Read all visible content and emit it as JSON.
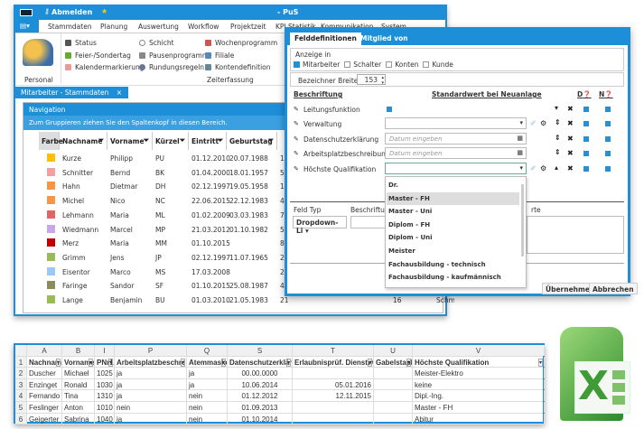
{
  "app": {
    "title": "- PuS",
    "logout": "Abmelden"
  },
  "ribbon": {
    "tabs": [
      "Stammdaten",
      "Planung",
      "Auswertung",
      "Workflow",
      "Projektzeit",
      "KPI Statistik",
      "Kommunikation",
      "System"
    ],
    "personal": "Personal",
    "group_label": "Zeiterfassung",
    "items": [
      "Status",
      "Feier-/Sondertag",
      "Kalendermarkierung",
      "Schicht",
      "Pausenprogramm",
      "Rundungsregeln",
      "Wochenprogramm",
      "Filiale",
      "Kontendefinition"
    ]
  },
  "doc_tab": {
    "label": "Mitarbeiter - Stammdaten",
    "close": "×"
  },
  "grid": {
    "nav": "Navigation",
    "group_hint": "Zum Gruppieren ziehen Sie den Spaltenkopf in diesen Bereich.",
    "columns": [
      "Farbe",
      "Nachname",
      "Vorname",
      "Kürzel",
      "Eintritt",
      "Geburtstag"
    ],
    "rows": [
      {
        "color": "#ffc000",
        "c": [
          "Kurze",
          "Philipp",
          "PU",
          "01.12.2010",
          "20.07.1988",
          "1"
        ]
      },
      {
        "color": "#f4a0a0",
        "c": [
          "Schnitter",
          "Bernd",
          "BK",
          "01.04.2000",
          "18.01.1957",
          "5"
        ]
      },
      {
        "color": "#f79646",
        "c": [
          "Hahn",
          "Dietmar",
          "DH",
          "02.12.1997",
          "19.05.1958",
          "1"
        ]
      },
      {
        "color": "#f79646",
        "c": [
          "Michel",
          "Nico",
          "NC",
          "22.06.2015",
          "22.12.1983",
          "4"
        ]
      },
      {
        "color": "#e06666",
        "c": [
          "Lehmann",
          "Maria",
          "ML",
          "01.02.2009",
          "03.03.1983",
          "7"
        ]
      },
      {
        "color": "#c4a8e8",
        "c": [
          "Wiedmann",
          "Marcel",
          "MP",
          "21.03.2012",
          "01.10.1982",
          "5"
        ]
      },
      {
        "color": "#c00000",
        "c": [
          "Merz",
          "Maria",
          "MM",
          "01.10.2015",
          "",
          "8"
        ]
      },
      {
        "color": "#9bbb59",
        "c": [
          "Grimm",
          "Jens",
          "JP",
          "02.12.1997",
          "11.07.1965",
          "2"
        ]
      },
      {
        "color": "#9cc8f4",
        "c": [
          "Eisentor",
          "Marco",
          "MS",
          "17.03.2008",
          "",
          "2"
        ]
      },
      {
        "color": "#8c8c5a",
        "c": [
          "Faringe",
          "Sandor",
          "SF",
          "01.10.2015",
          "25.08.1987",
          "4"
        ]
      },
      {
        "color": "#9bbb59",
        "c": [
          "Lange",
          "Benjamin",
          "BU",
          "01.03.2010",
          "21.05.1983",
          "21"
        ]
      }
    ],
    "extra": [
      "16",
      "Schmelzhüttenstr."
    ]
  },
  "dialog": {
    "tabs": [
      "Felddefinitionen",
      "Mitglied von"
    ],
    "anzeige_label": "Anzeige in",
    "anzeige": [
      {
        "label": "Mitarbeiter",
        "checked": true
      },
      {
        "label": "Schalter",
        "checked": false
      },
      {
        "label": "Konten",
        "checked": false
      },
      {
        "label": "Kunde",
        "checked": false
      }
    ],
    "breite_label": "Bezeichner Breite",
    "breite_value": "153",
    "col_label": "Beschriftung",
    "col_default": "Standardwert bei Neuanlage",
    "col_d": "D",
    "col_n": "N",
    "fields": [
      "Leitungsfunktion",
      "Verwaltung",
      "Datenschutzerklärung",
      "Arbeitsplatzbeschreibung",
      "Höchste Qualifikation"
    ],
    "date_placeholder": "Datum eingeben",
    "options": [
      "Dr.",
      "Master - FH",
      "Master - Uni",
      "Diplom - FH",
      "Diplom - Uni",
      "Meister",
      "Fachausbildung - technisch",
      "Fachausbildung - kaufmännisch"
    ],
    "selected_option": "Master - FH",
    "feld_typ_label": "Feld Typ",
    "feld_typ_value": "Dropdown-Li",
    "beschriftung_label": "Beschriftung",
    "werte_label": "rte",
    "ok": "Übernehmen",
    "cancel": "Abbrechen"
  },
  "excel": {
    "col_letters": [
      "",
      "A",
      "B",
      "I",
      "P",
      "Q",
      "S",
      "T",
      "U",
      "V"
    ],
    "headers": [
      "Nachname",
      "Vorname",
      "PNr1",
      "Arbeitsplatzbeschreibung",
      "Atemmaske",
      "Datenschutzerklärung",
      "Erlaubnisprüf. Dienstwagen",
      "Gabelstapler",
      "Höchste Qualifikation"
    ],
    "rows": [
      [
        "Duscher",
        "Michael",
        "1025",
        "ja",
        "ja",
        "00.00.0000",
        "",
        "",
        "Meister-Elektro"
      ],
      [
        "Enzinget",
        "Ronald",
        "1030",
        "ja",
        "ja",
        "10.06.2014",
        "05.01.2016",
        "",
        "keine"
      ],
      [
        "Fernando",
        "Tina",
        "1310",
        "ja",
        "nein",
        "01.12.2012",
        "12.11.2015",
        "",
        "Dipl.-Ing."
      ],
      [
        "Feslinger",
        "Anton",
        "1010",
        "nein",
        "nein",
        "01.09.2013",
        "",
        "",
        "Master - FH"
      ],
      [
        "Geigerter",
        "Sabrina",
        "1040",
        "ja",
        "nein",
        "01.10.2014",
        "",
        "",
        "Abitur"
      ]
    ]
  },
  "colors": {
    "accent": "#1d8fd8",
    "excel_green": "#3f9b35"
  }
}
